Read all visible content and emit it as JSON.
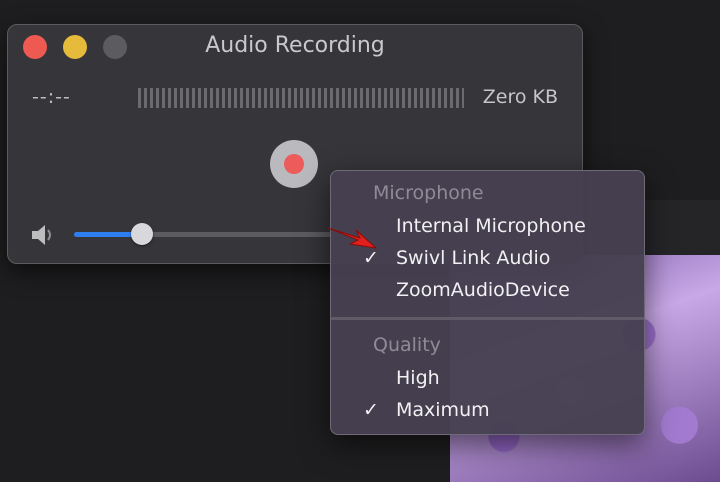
{
  "window": {
    "title": "Audio Recording",
    "elapsed_time": "--:--",
    "file_size": "Zero KB",
    "volume_level": 0.26
  },
  "menu": {
    "sections": [
      {
        "title": "Microphone",
        "items": [
          {
            "label": "Internal Microphone",
            "checked": false
          },
          {
            "label": "Swivl Link Audio",
            "checked": true
          },
          {
            "label": "ZoomAudioDevice",
            "checked": false
          }
        ]
      },
      {
        "title": "Quality",
        "items": [
          {
            "label": "High",
            "checked": false
          },
          {
            "label": "Maximum",
            "checked": true
          }
        ]
      }
    ],
    "check_glyph": "✓"
  },
  "colors": {
    "close": "#ee5a52",
    "minimize": "#e6bb3c",
    "record": "#ee5b5b",
    "slider_fill": "#2f7ef0",
    "pointer": "#e0201c"
  },
  "icons": [
    "close-icon",
    "minimize-icon",
    "zoom-icon",
    "record-icon",
    "speaker-icon",
    "checkmark-icon",
    "pointer-arrow-icon"
  ]
}
